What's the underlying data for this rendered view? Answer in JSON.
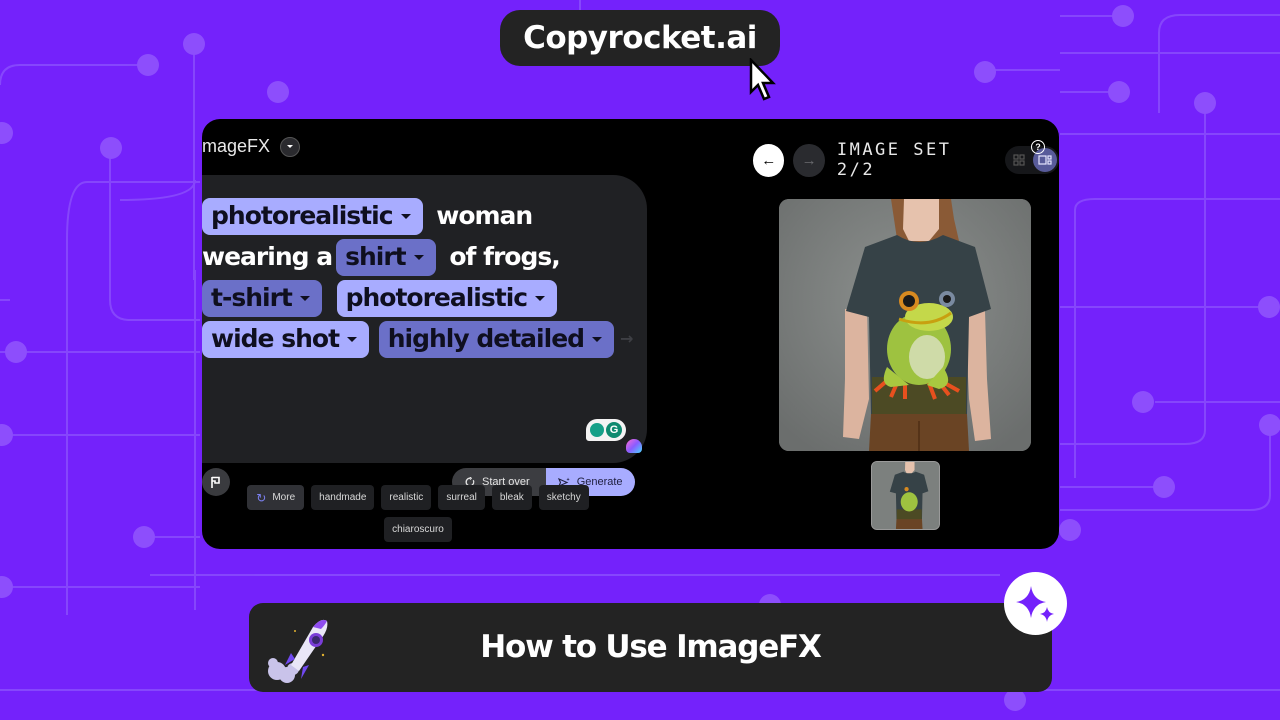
{
  "brand": {
    "name": "Copyrocket.ai"
  },
  "app": {
    "title": "mageFX",
    "prompt": {
      "segments": [
        {
          "type": "chip",
          "style": "light",
          "text": "photorealistic"
        },
        {
          "type": "word",
          "text": "woman"
        },
        {
          "type": "word",
          "text": "wearing a"
        },
        {
          "type": "chip",
          "style": "dark",
          "text": "shirt"
        },
        {
          "type": "word",
          "text": "of frogs,"
        },
        {
          "type": "chip",
          "style": "dark",
          "text": "t-shirt"
        },
        {
          "type": "chip",
          "style": "light",
          "text": "photorealistic"
        },
        {
          "type": "chip",
          "style": "light",
          "text": "wide shot"
        },
        {
          "type": "chip",
          "style": "dark",
          "text": "highly detailed"
        }
      ]
    },
    "actions": {
      "start_over": "Start over",
      "generate": "Generate"
    },
    "suggestions": {
      "more": "More",
      "items": [
        "handmade",
        "realistic",
        "surreal",
        "bleak",
        "sketchy",
        "chiaroscuro"
      ]
    },
    "image_set": {
      "label": "IMAGE SET 2/2",
      "current": 2,
      "total": 2
    },
    "help": "?",
    "extension": {
      "grammarly_letter": "G"
    }
  },
  "banner": {
    "title": "How to Use ImageFX"
  },
  "colors": {
    "background": "#7422fb",
    "chip_light": "#a8acff",
    "chip_dark": "#6b70c8",
    "panel": "#202124",
    "banner": "#232323"
  }
}
